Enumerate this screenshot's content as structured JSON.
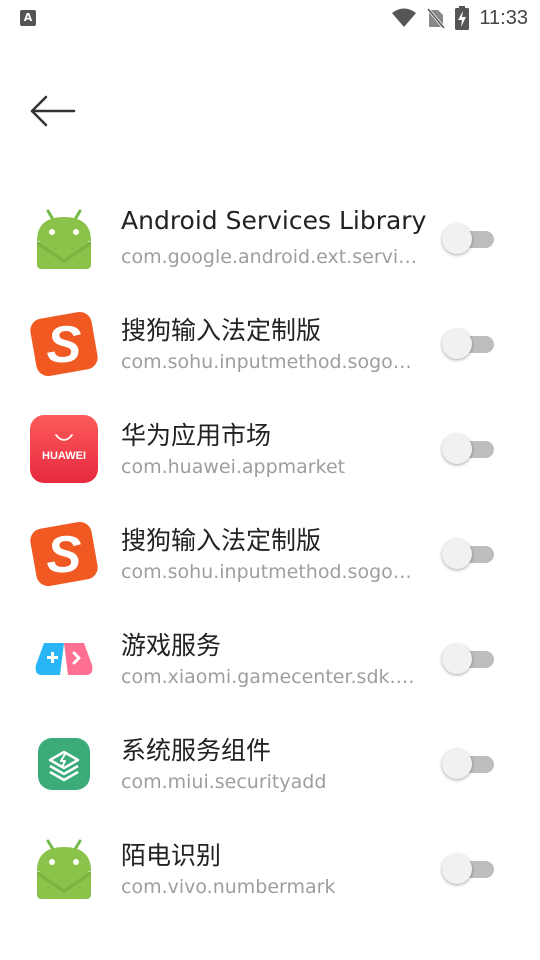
{
  "status_bar": {
    "left_icon": "A",
    "time": "11:33",
    "icons": [
      "wifi-icon",
      "no-sim-icon",
      "battery-charging-icon"
    ]
  },
  "header": {
    "back_icon": "arrow-left-icon"
  },
  "apps": [
    {
      "name": "Android Services Library",
      "package": "com.google.android.ext.services",
      "icon": "android-icon",
      "enabled": false
    },
    {
      "name": "搜狗输入法定制版",
      "package": "com.sohu.inputmethod.sogou.xiaomi",
      "icon": "sogou-icon",
      "enabled": false
    },
    {
      "name": "华为应用市场",
      "package": "com.huawei.appmarket",
      "icon": "huawei-appmarket-icon",
      "icon_text": "HUAWEI",
      "enabled": false
    },
    {
      "name": "搜狗输入法定制版",
      "package": "com.sohu.inputmethod.sogou.xiaomi",
      "icon": "sogou-icon",
      "enabled": false
    },
    {
      "name": "游戏服务",
      "package": "com.xiaomi.gamecenter.sdk.service",
      "icon": "game-service-icon",
      "enabled": false
    },
    {
      "name": "系统服务组件",
      "package": "com.miui.securityadd",
      "icon": "system-service-icon",
      "enabled": false
    },
    {
      "name": "陌电识别",
      "package": "com.vivo.numbermark",
      "icon": "android-icon",
      "enabled": false
    }
  ]
}
